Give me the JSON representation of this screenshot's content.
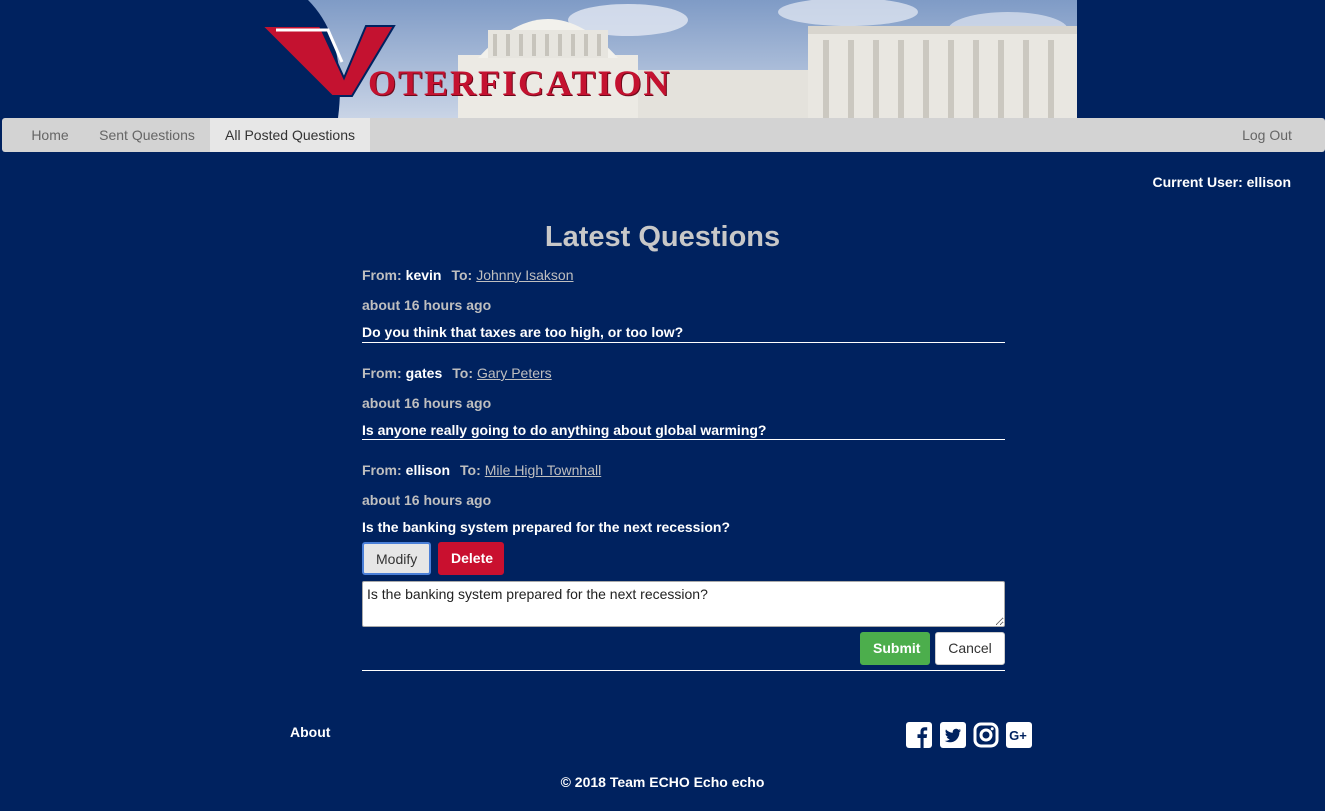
{
  "banner": {
    "title_initial": "V",
    "title_rest": "OTERFICATION"
  },
  "nav": {
    "items": [
      {
        "label": "Home",
        "active": false
      },
      {
        "label": "Sent Questions",
        "active": false
      },
      {
        "label": "All Posted Questions",
        "active": true
      }
    ],
    "logout": "Log Out"
  },
  "current_user": "Current User: ellison",
  "page_title": "Latest Questions",
  "questions": [
    {
      "from_label": "From:",
      "from_user": "kevin",
      "to_label": "To:",
      "to_rep": "Johnny Isakson",
      "time": "about 16 hours ago",
      "text": "Do you think that taxes are too high, or too low?"
    },
    {
      "from_label": "From:",
      "from_user": "gates",
      "to_label": "To:",
      "to_rep": "Gary Peters",
      "time": "about 16 hours ago",
      "text": "Is anyone really going to do anything about global warming?"
    },
    {
      "from_label": "From:",
      "from_user": "ellison",
      "to_label": "To:",
      "to_rep": "Mile High Townhall",
      "time": "about 16 hours ago",
      "text": "Is the banking system prepared for the next recession?",
      "actions": {
        "modify": "Modify",
        "delete": "Delete"
      },
      "edit": {
        "value": "Is the banking system prepared for the next recession?",
        "submit": "Submit",
        "cancel": "Cancel"
      }
    }
  ],
  "footer": {
    "about": "About",
    "social_icons": [
      "facebook-icon",
      "twitter-icon",
      "instagram-icon",
      "google-plus-icon"
    ],
    "copyright": "© 2018 Team ECHO Echo echo"
  },
  "colors": {
    "background": "#00225f",
    "navbar": "#d3d3d3",
    "delete": "#c9102f",
    "submit": "#4cae4c",
    "logo_red": "#c41230"
  }
}
